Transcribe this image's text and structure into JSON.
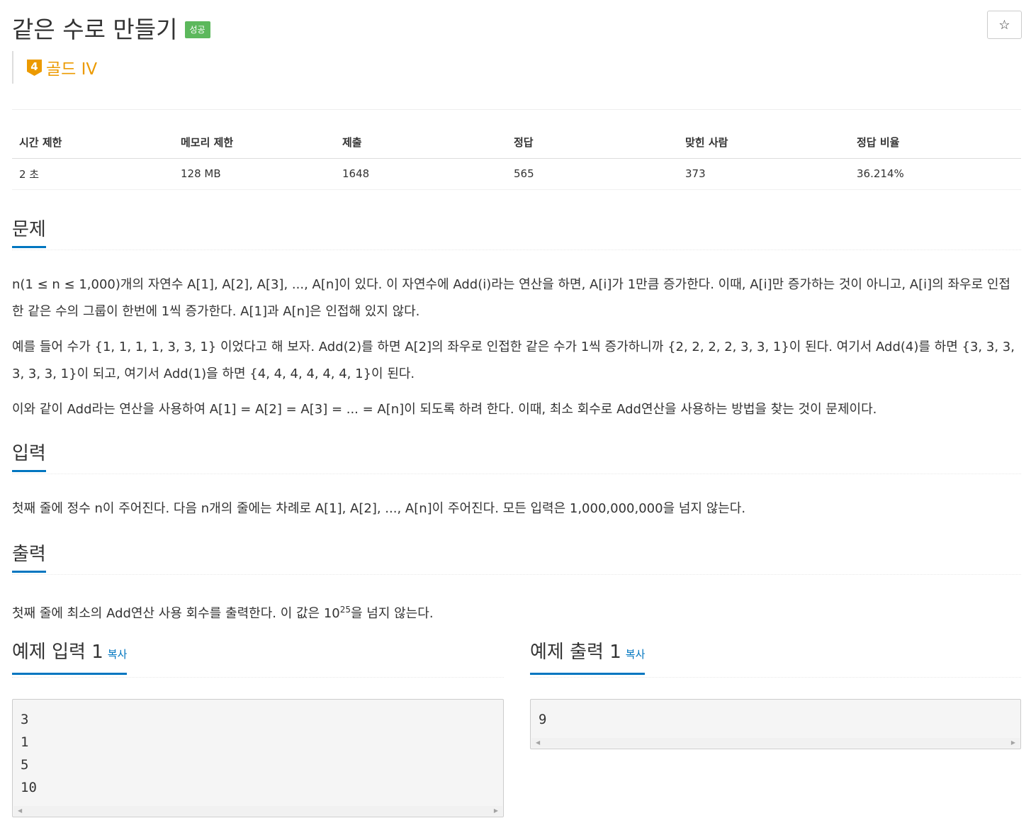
{
  "header": {
    "title": "같은 수로 만들기",
    "badge": "성공",
    "star_icon": "☆",
    "tier": {
      "number": "4",
      "label": "골드 IV",
      "color": "#ec9a00"
    }
  },
  "info_table": {
    "headers": [
      "시간 제한",
      "메모리 제한",
      "제출",
      "정답",
      "맞힌 사람",
      "정답 비율"
    ],
    "values": [
      "2 초",
      "128 MB",
      "1648",
      "565",
      "373",
      "36.214%"
    ]
  },
  "problem": {
    "title": "문제",
    "paragraphs": [
      "n(1 ≤ n ≤ 1,000)개의 자연수 A[1], A[2], A[3], ..., A[n]이 있다. 이 자연수에 Add(i)라는 연산을 하면, A[i]가 1만큼 증가한다. 이때, A[i]만 증가하는 것이 아니고, A[i]의 좌우로 인접한 같은 수의 그룹이 한번에 1씩 증가한다. A[1]과 A[n]은 인접해 있지 않다.",
      "예를 들어 수가 {1, 1, 1, 1, 3, 3, 1} 이었다고 해 보자. Add(2)를 하면 A[2]의 좌우로 인접한 같은 수가 1씩 증가하니까 {2, 2, 2, 2, 3, 3, 1}이 된다. 여기서 Add(4)를 하면 {3, 3, 3, 3, 3, 3, 1}이 되고, 여기서 Add(1)을 하면 {4, 4, 4, 4, 4, 4, 1}이 된다.",
      "이와 같이 Add라는 연산을 사용하여 A[1] = A[2] = A[3] = ... = A[n]이 되도록 하려 한다. 이때, 최소 회수로 Add연산을 사용하는 방법을 찾는 것이 문제이다."
    ]
  },
  "input": {
    "title": "입력",
    "text": "첫째 줄에 정수 n이 주어진다. 다음 n개의 줄에는 차례로 A[1], A[2], ..., A[n]이 주어진다. 모든 입력은 1,000,000,000을 넘지 않는다."
  },
  "output": {
    "title": "출력",
    "text_before": "첫째 줄에 최소의 Add연산 사용 회수를 출력한다. 이 값은 10",
    "sup": "25",
    "text_after": "을 넘지 않는다."
  },
  "samples": {
    "input": {
      "title": "예제 입력 1",
      "copy": "복사",
      "content": "3\n1\n5\n10"
    },
    "output": {
      "title": "예제 출력 1",
      "copy": "복사",
      "content": "9"
    }
  },
  "colors": {
    "accent": "#0076c0",
    "badge": "#5cb85c",
    "tier": "#ec9a00"
  }
}
